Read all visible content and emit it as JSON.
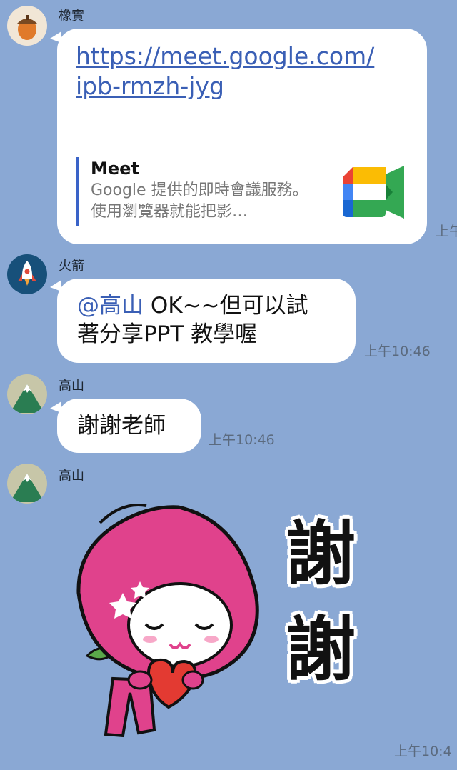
{
  "messages": [
    {
      "sender": "橡實",
      "avatar_icon": "acorn-icon",
      "link_text": "https://meet.google.com/ipb-rmzh-jyg",
      "link_line1": "https://meet.google.com/",
      "link_line2": "ipb-rmzh-jyg",
      "preview_title": "Meet",
      "preview_desc": "Google 提供的即時會議服務。使用瀏覽器就能把影…",
      "preview_icon": "google-meet-icon",
      "time": "上午"
    },
    {
      "sender": "火箭",
      "avatar_icon": "rocket-icon",
      "mention": "@高山",
      "text_line1": " OK~~但可以試",
      "text_line2": "著分享PPT 教學喔",
      "time": "上午10:46"
    },
    {
      "sender": "高山",
      "avatar_icon": "mountain-icon",
      "text": "謝謝老師",
      "time": "上午10:46"
    },
    {
      "sender": "高山",
      "avatar_icon": "mountain-icon",
      "sticker_icon": "peach-character-sticker",
      "sticker_text_1": "謝",
      "sticker_text_2": "謝",
      "time": "上午10:4"
    }
  ],
  "colors": {
    "background": "#8aa8d4",
    "bubble": "#ffffff",
    "link": "#3a5fb5",
    "sticker_pink": "#e0428c"
  }
}
